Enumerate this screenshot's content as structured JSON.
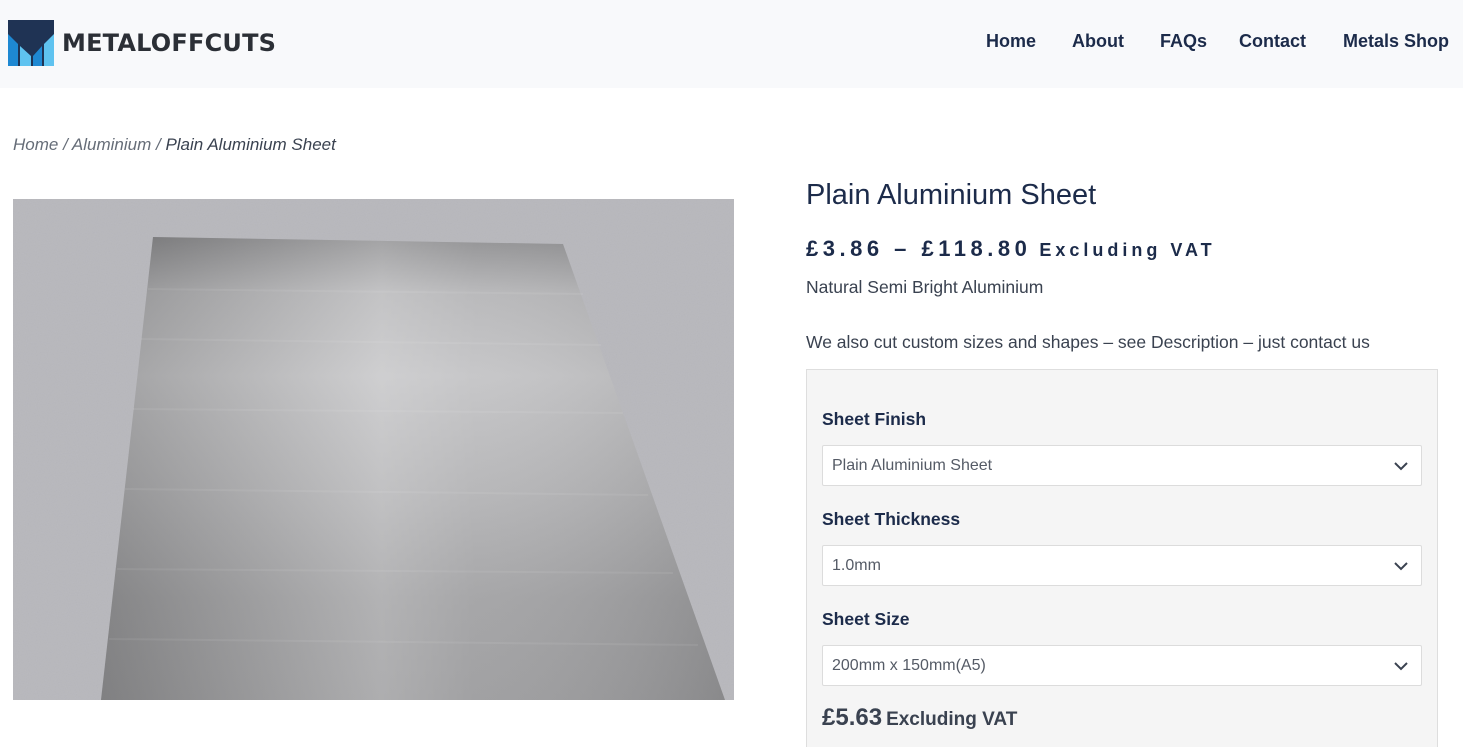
{
  "brand": {
    "name": "METALOFFCUTS",
    "colors": {
      "logo_dark": "#1f3354",
      "logo_blue": "#1e88d2",
      "logo_light": "#5fc3f0"
    }
  },
  "nav": {
    "items": [
      {
        "label": "Home"
      },
      {
        "label": "About"
      },
      {
        "label": "FAQs"
      },
      {
        "label": "Contact"
      },
      {
        "label": "Metals Shop"
      }
    ]
  },
  "breadcrumb": {
    "home": "Home",
    "separator": " / ",
    "category": "Aluminium",
    "current": "Plain Aluminium Sheet"
  },
  "product": {
    "image_icon": "aluminium-sheet-photo",
    "title": "Plain Aluminium Sheet",
    "price_range": "£3.86 – £118.80",
    "price_suffix": "Excluding VAT",
    "short_description": "Natural Semi Bright Aluminium",
    "custom_note": "We also cut custom sizes and shapes – see Description – just contact us"
  },
  "variations": {
    "finish": {
      "label": "Sheet Finish",
      "selected": "Plain Aluminium Sheet"
    },
    "thickness": {
      "label": "Sheet Thickness",
      "selected": "1.0mm"
    },
    "size": {
      "label": "Sheet Size",
      "selected": "200mm x 150mm(A5)"
    },
    "price": "£5.63",
    "price_suffix": "Excluding VAT"
  }
}
